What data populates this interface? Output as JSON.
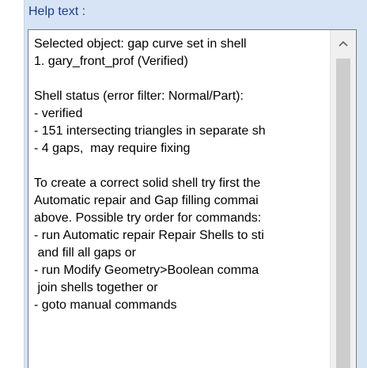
{
  "panel": {
    "label": "Help text :"
  },
  "help_text": {
    "lines": [
      "Selected object: gap curve set in shell",
      "1. gary_front_prof (Verified)",
      "",
      "Shell status (error filter: Normal/Part):",
      "- verified",
      "- 151 intersecting triangles in separate sh",
      "- 4 gaps,  may require fixing",
      "",
      "To create a correct solid shell try first the",
      "Automatic repair and Gap filling commai",
      "above. Possible try order for commands:",
      "- run Automatic repair Repair Shells to sti",
      " and fill all gaps or",
      "- run Modify Geometry>Boolean comma",
      " join shells together or",
      "- goto manual commands"
    ]
  },
  "scrollbar": {
    "up_icon": "chevron-up-icon"
  },
  "colors": {
    "panel_background": "#d6e4f5",
    "label_text": "#1c3f8c",
    "scroll_thumb": "#cdcdcd"
  }
}
